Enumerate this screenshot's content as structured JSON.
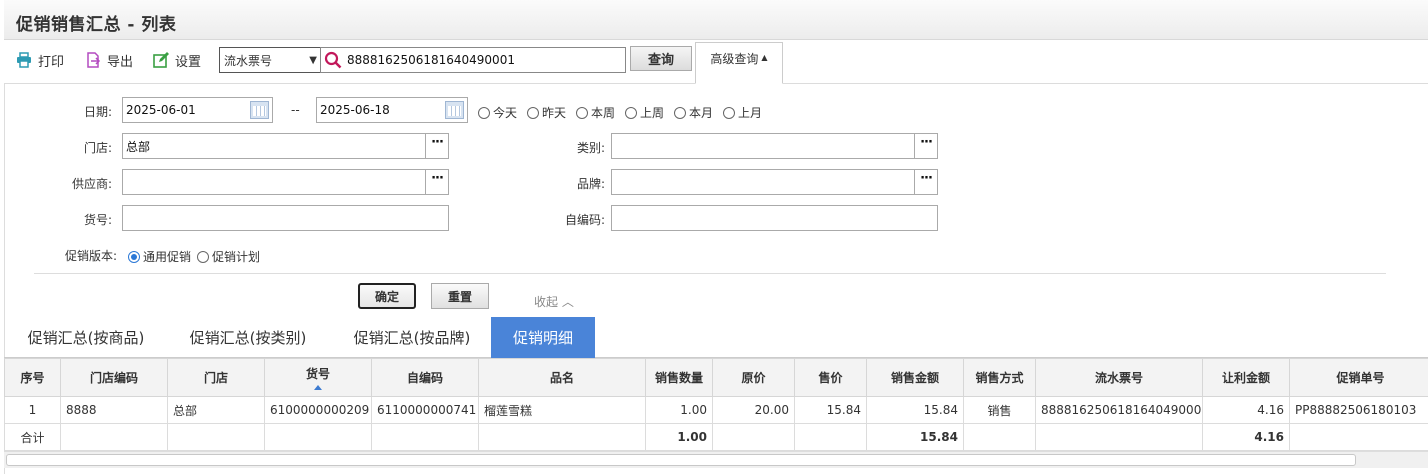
{
  "title": "促销销售汇总 - 列表",
  "toolbar": {
    "print_label": "打印",
    "export_label": "导出",
    "settings_label": "设置",
    "search_field_selected": "流水票号",
    "search_value": "8888162506181640490001",
    "query_label": "查询",
    "advanced_label": "高级查询"
  },
  "form": {
    "date_label": "日期:",
    "date_from": "2025-06-01",
    "date_sep": "--",
    "date_to": "2025-06-18",
    "quick_dates": [
      "今天",
      "昨天",
      "本周",
      "上周",
      "本月",
      "上月"
    ],
    "store_label": "门店:",
    "store_value": "总部",
    "category_label": "类别:",
    "category_value": "",
    "supplier_label": "供应商:",
    "supplier_value": "",
    "brand_label": "品牌:",
    "brand_value": "",
    "item_no_label": "货号:",
    "item_no_value": "",
    "self_code_label": "自编码:",
    "self_code_value": "",
    "promo_version_label": "促销版本:",
    "promo_options": [
      "通用促销",
      "促销计划"
    ],
    "promo_selected": "通用促销",
    "dots": "···",
    "confirm_label": "确定",
    "reset_label": "重置",
    "collapse_label": "收起 ︿"
  },
  "tabs": [
    "促销汇总(按商品)",
    "促销汇总(按类别)",
    "促销汇总(按品牌)",
    "促销明细"
  ],
  "active_tab": "促销明细",
  "table": {
    "columns": [
      "序号",
      "门店编码",
      "门店",
      "货号",
      "自编码",
      "品名",
      "销售数量",
      "原价",
      "售价",
      "销售金额",
      "销售方式",
      "流水票号",
      "让利金额",
      "促销单号"
    ],
    "rows": [
      [
        "1",
        "8888",
        "总部",
        "6100000000209",
        "6110000000741",
        "榴莲雪糕",
        "1.00",
        "20.00",
        "15.84",
        "15.84",
        "销售",
        "8888162506181640490001",
        "4.16",
        "PP88882506180103"
      ]
    ],
    "total_label": "合计",
    "totals": {
      "qty": "1.00",
      "amount": "15.84",
      "discount": "4.16"
    }
  },
  "colors": {
    "accent": "#4a84d8",
    "print_icon": "#2e9bb3",
    "export_icon": "#b44bc0",
    "settings_icon": "#3aa043",
    "search_icon": "#c2185b"
  }
}
